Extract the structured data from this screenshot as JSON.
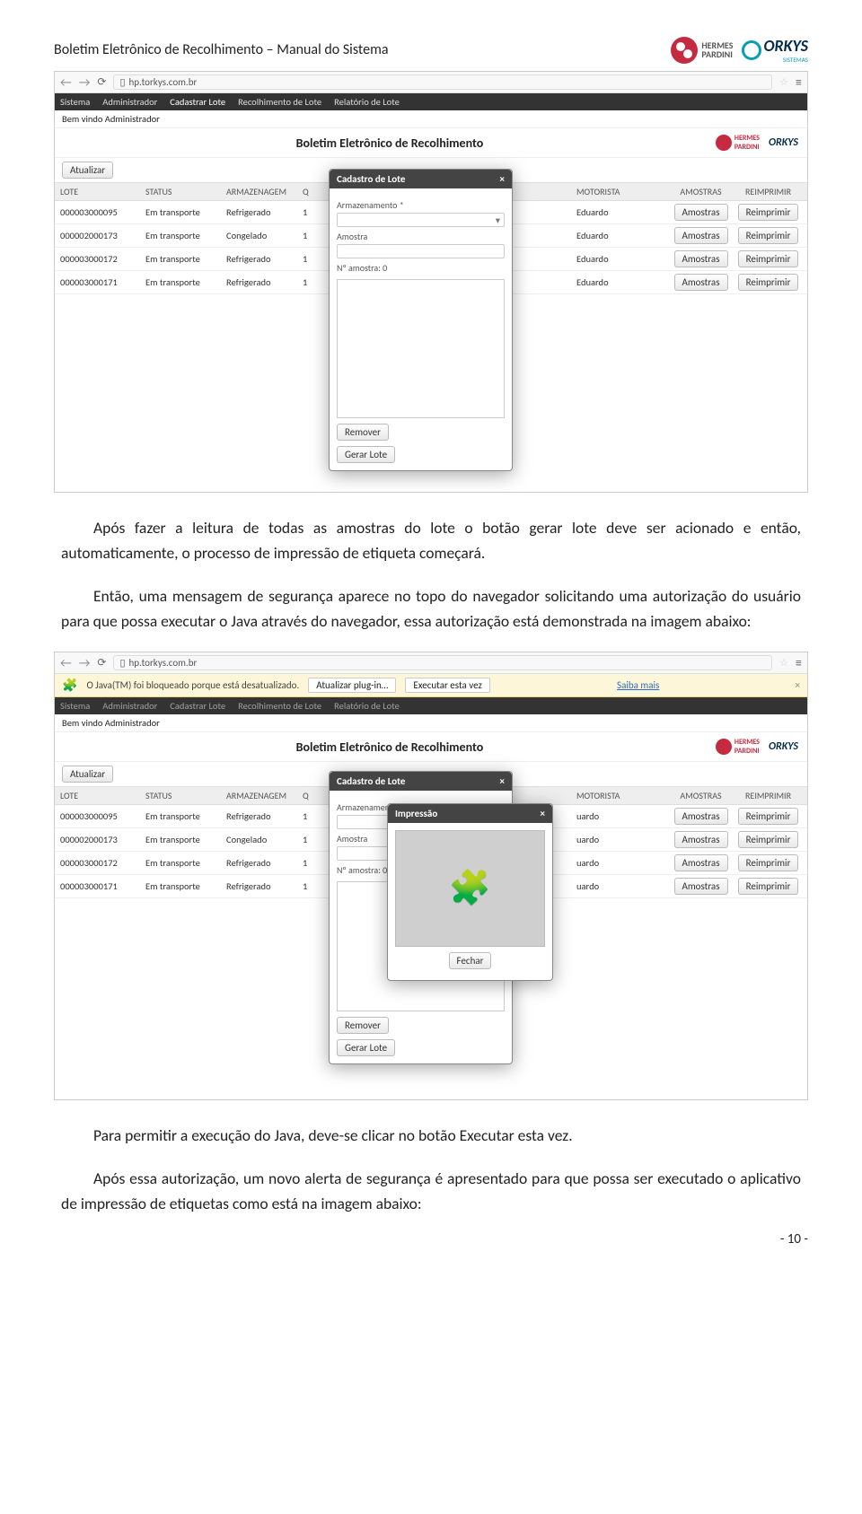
{
  "doc_header": {
    "title": "Boletim Eletrônico de Recolhimento – Manual do Sistema",
    "hermes_line1": "HERMES",
    "hermes_line2": "PARDINI",
    "torkys": "ORKYS",
    "torkys_sub": "SISTEMAS"
  },
  "browser": {
    "url": "hp.torkys.com.br"
  },
  "java_warning": {
    "msg": "O Java(TM) foi bloqueado porque está desatualizado.",
    "btn_update": "Atualizar plug-in…",
    "btn_run": "Executar esta vez",
    "link": "Saiba mais"
  },
  "app": {
    "menu": [
      "Sistema",
      "Administrador",
      "Cadastrar Lote",
      "Recolhimento de Lote",
      "Relatório de Lote"
    ],
    "welcome": "Bem vindo Administrador",
    "title": "Boletim Eletrônico de Recolhimento",
    "btn_atualizar": "Atualizar",
    "col_lote": "LOTE",
    "col_status": "STATUS",
    "col_arm": "ARMAZENAGEM",
    "col_q": "Q",
    "col_mot": "MOTORISTA",
    "col_am": "AMOSTRAS",
    "col_re": "REIMPRIMIR",
    "btn_amostras": "Amostras",
    "btn_reimprimir": "Reimprimir",
    "rows": [
      {
        "lote": "000003000095",
        "status": "Em transporte",
        "arm": "Refrigerado",
        "q": "1",
        "mot": "Eduardo"
      },
      {
        "lote": "000002000173",
        "status": "Em transporte",
        "arm": "Congelado",
        "q": "1",
        "mot": "Eduardo"
      },
      {
        "lote": "000003000172",
        "status": "Em transporte",
        "arm": "Refrigerado",
        "q": "1",
        "mot": "Eduardo"
      },
      {
        "lote": "000003000171",
        "status": "Em transporte",
        "arm": "Refrigerado",
        "q": "1",
        "mot": "Eduardo"
      }
    ]
  },
  "cadastro_modal": {
    "title": "Cadastro de Lote",
    "lbl_arm": "Armazenamento *",
    "lbl_amostra": "Amostra",
    "lbl_namostra": "Nº amostra: 0",
    "btn_remover": "Remover",
    "btn_gerar": "Gerar Lote"
  },
  "impressao_modal": {
    "title": "Impressão",
    "btn_fechar": "Fechar"
  },
  "paragraphs": {
    "p1": "Após fazer a leitura de todas as amostras do lote o botão gerar lote deve ser acionado e então, automaticamente, o processo de impressão de etiqueta começará.",
    "p2": "Então, uma mensagem de segurança aparece no topo do navegador solicitando uma autorização do usuário para que possa executar o Java através do navegador, essa autorização está demonstrada na imagem abaixo:",
    "p3": "Para permitir a execução do Java, deve-se clicar no botão Executar esta vez.",
    "p4": "Após essa autorização, um novo alerta de segurança é apresentado para que possa ser executado o aplicativo de impressão de etiquetas como está na imagem abaixo:"
  },
  "page_num": "- 10 -"
}
